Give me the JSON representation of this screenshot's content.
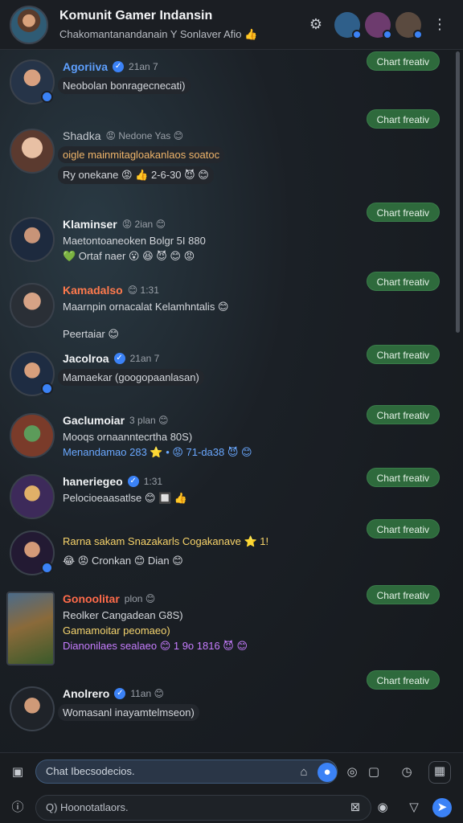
{
  "header": {
    "title": "Komunit Gamer Indansin",
    "subtitle": "Chakomantanandanain  Y Sonlaver Afio 👍"
  },
  "chat_button_label": "Chart freativ",
  "messages": [
    {
      "name": "Agoriiva",
      "meta": "21an 7",
      "verified": true,
      "lines": [
        "Neobolan bonragecnecati)"
      ]
    },
    {
      "name": "Shadka",
      "meta": "😡 Nedone Yas 😊",
      "verified": false,
      "lines": [
        "oigle mainmitagloakanlaos soatoc",
        "Ry onekane 😡 👍 2-6-30 😈 😊"
      ]
    },
    {
      "name": "Klaminser",
      "meta": "😡 2ian 😊",
      "verified": false,
      "lines": [
        "Maetontoaneoken Bolgr 5I 880",
        "💚 Ortaf naer 😮 😆 😈 😊 😡"
      ]
    },
    {
      "name": "Kamadalso",
      "meta": "😊 1:31",
      "verified": false,
      "lines": [
        "Maarnpin ornacalat Kelamhntalis 😊",
        "Peertaiar 😊"
      ]
    },
    {
      "name": "Jacolroa",
      "meta": "21an 7",
      "verified": true,
      "lines": [
        "Mamaekar (googopaanlasan)"
      ]
    },
    {
      "name": "Gaclumoiar",
      "meta": "3 plan 😊",
      "verified": false,
      "lines": [
        "Mooqs ornaanntecrtha 80S)",
        "Menandamao 283 ⭐ • 😡 71-da38 😈 😊"
      ]
    },
    {
      "name": "haneriegeo",
      "meta": "1:31",
      "verified": true,
      "lines": [
        "Pelocioeaasatlse 😊 🔲 👍"
      ]
    },
    {
      "name": "",
      "meta": "",
      "verified": false,
      "lines": [
        "Rarna sakam Snazakarls Cogakanave ⭐ 1!",
        "😂 😡 Cronkan 😊 Dian 😊"
      ]
    },
    {
      "name": "Gonoolitar",
      "meta": "plon 😊",
      "verified": false,
      "lines": [
        "Reolker Cangadean G8S)",
        "Gamamoitar peomaeo)",
        "Dianonilaes sealaeo 😊 1 9o 1816 😈 😊"
      ]
    },
    {
      "name": "Anolrero",
      "meta": "11an 😊",
      "verified": true,
      "lines": [
        "Womasanl inayamtelmseon)"
      ]
    }
  ],
  "composer": {
    "message_placeholder": "Chat Ibecsodecios.",
    "search_placeholder": "Q) Hoonotatlaors."
  },
  "colors": {
    "accent": "#3b82f6",
    "chat_button": "#2e6a3c",
    "background": "#15181c"
  }
}
